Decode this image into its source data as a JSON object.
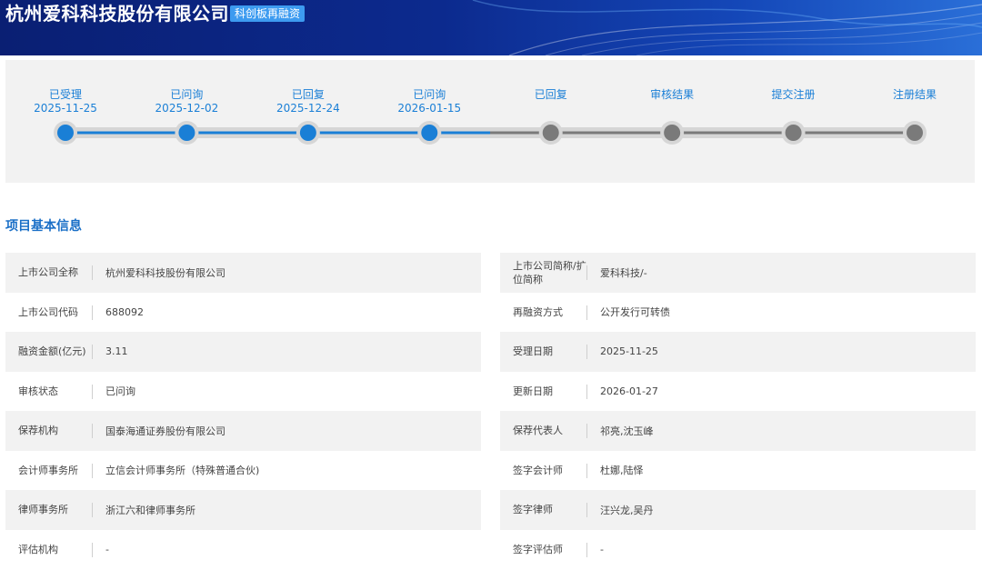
{
  "header": {
    "company_name": "杭州爱科科技股份有限公司",
    "board_tag": "科创板再融资"
  },
  "progress": {
    "steps": [
      {
        "label": "已受理",
        "date": "2025-11-25",
        "done": true
      },
      {
        "label": "已问询",
        "date": "2025-12-02",
        "done": true
      },
      {
        "label": "已回复",
        "date": "2025-12-24",
        "done": true
      },
      {
        "label": "已问询",
        "date": "2026-01-15",
        "done": true
      },
      {
        "label": "已回复",
        "date": "",
        "done": false
      },
      {
        "label": "审核结果",
        "date": "",
        "done": false
      },
      {
        "label": "提交注册",
        "date": "",
        "done": false
      },
      {
        "label": "注册结果",
        "date": "",
        "done": false
      }
    ],
    "active_color": "#1a7fd6",
    "inactive_color": "#7a7a7a",
    "track_color": "#d6d6d6"
  },
  "section": {
    "title": "项目基本信息"
  },
  "info": {
    "left": [
      {
        "label": "上市公司全称",
        "value": "杭州爱科科技股份有限公司"
      },
      {
        "label": "上市公司代码",
        "value": "688092"
      },
      {
        "label": "融资金额(亿元)",
        "value": "3.11"
      },
      {
        "label": "审核状态",
        "value": "已问询"
      },
      {
        "label": "保荐机构",
        "value": "国泰海通证券股份有限公司"
      },
      {
        "label": "会计师事务所",
        "value": "立信会计师事务所（特殊普通合伙)"
      },
      {
        "label": "律师事务所",
        "value": "浙江六和律师事务所"
      },
      {
        "label": "评估机构",
        "value": "-"
      }
    ],
    "right": [
      {
        "label": "上市公司简称/扩位简称",
        "value": "爱科科技/-"
      },
      {
        "label": "再融资方式",
        "value": "公开发行可转债"
      },
      {
        "label": "受理日期",
        "value": "2025-11-25"
      },
      {
        "label": "更新日期",
        "value": "2026-01-27"
      },
      {
        "label": "保荐代表人",
        "value": "祁亮,沈玉峰"
      },
      {
        "label": "签字会计师",
        "value": "杜娜,陆怿"
      },
      {
        "label": "签字律师",
        "value": "汪兴龙,吴丹"
      },
      {
        "label": "签字评估师",
        "value": "-"
      }
    ]
  }
}
